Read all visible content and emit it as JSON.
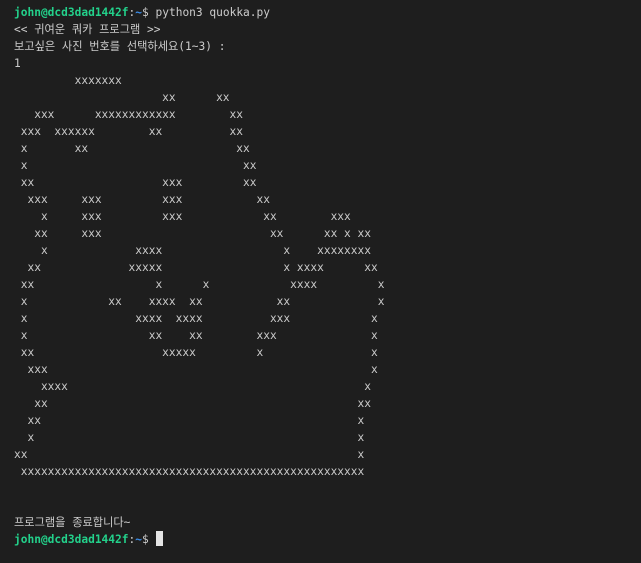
{
  "prompt": {
    "user": "john@dcd3dad1442f",
    "sep": ":",
    "path": "~",
    "symbol": "$ "
  },
  "command": "python3 quokka.py",
  "output": {
    "title": "<< 귀여운 쿼카 프로그램 >>",
    "question": "보고싶은 사진 번호를 선택하세요(1~3) :",
    "answer": "1",
    "ascii_art": "         xxxxxxx\n                      xx      xx\n   xxx      xxxxxxxxxxxx        xx\n xxx  xxxxxx        xx          xx\n x       xx                      xx\n x                                xx\n xx                   xxx         xx\n  xxx     xxx         xxx           xx\n    x     xxx         xxx            xx        xxx\n   xx     xxx                         xx      xx x xx\n    x             xxxx                  x    xxxxxxxx\n  xx             xxxxx                  x xxxx      xx\n xx                  x      x            xxxx         x\n x            xx    xxxx  xx           xx             x\n x                xxxx  xxxx          xxx            x\n x                  xx    xx        xxx              x\n xx                   xxxxx         x                x\n  xxx                                                x\n    xxxx                                            x\n   xx                                              xx\n  xx                                               x\n  x                                                x\nxx                                                 x\n xxxxxxxxxxxxxxxxxxxxxxxxxxxxxxxxxxxxxxxxxxxxxxxxxxx",
    "exit_message": "프로그램을 종료합니다~"
  }
}
